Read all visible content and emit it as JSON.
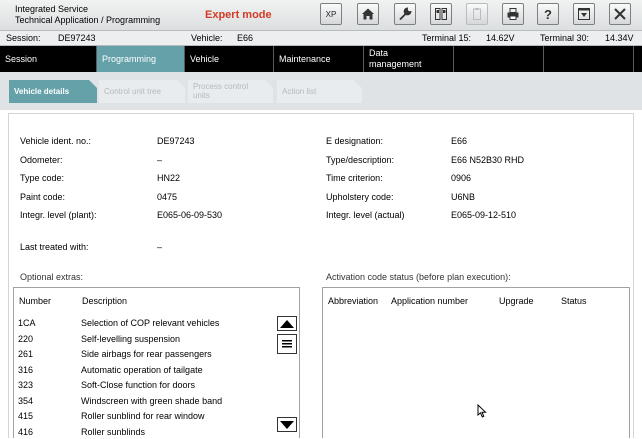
{
  "app": {
    "title_line1": "Integrated Service",
    "title_line2": "Technical Application / Programming",
    "mode": "Expert mode"
  },
  "toolbar": {
    "xp_label": "XP",
    "icons": [
      "home-icon",
      "wrench-icon",
      "device-icon",
      "clipboard-icon",
      "printer-icon",
      "help-icon",
      "minimize-icon",
      "close-icon"
    ]
  },
  "session": {
    "session_label": "Session:",
    "session_value": "DE97243",
    "vehicle_label": "Vehicle:",
    "vehicle_value": "E66",
    "t15_label": "Terminal 15:",
    "t15_value": "14.62V",
    "t30_label": "Terminal 30:",
    "t30_value": "14.34V"
  },
  "mainnav": {
    "session": "Session",
    "programming": "Programming",
    "vehicle": "Vehicle",
    "maintenance": "Maintenance",
    "data_mgmt_line1": "Data",
    "data_mgmt_line2": "management"
  },
  "subnav": {
    "vehicle_details": "Vehicle details",
    "control_unit_tree": "Control unit tree",
    "process_actions_line1": "Process control",
    "process_actions_line2": "units",
    "action_list": "Action list"
  },
  "details": {
    "vin_label": "Vehicle ident. no.:",
    "vin_value": "DE97243",
    "odometer_label": "Odometer:",
    "odometer_value": "–",
    "type_code_label": "Type code:",
    "type_code_value": "HN22",
    "paint_label": "Paint code:",
    "paint_value": "0475",
    "integr_plant_label": "Integr. level (plant):",
    "integr_plant_value": "E065-06-09-530",
    "last_treated_label": "Last treated with:",
    "last_treated_value": "–",
    "edesig_label": "E designation:",
    "edesig_value": "E66",
    "typedesc_label": "Type/description:",
    "typedesc_value": "E66 N52B30 RHD",
    "time_label": "Time criterion:",
    "time_value": "0906",
    "uphol_label": "Upholstery code:",
    "uphol_value": "U6NB",
    "integr_actual_label": "Integr. level (actual)",
    "integr_actual_value": "E065-09-12-510"
  },
  "optional_extras": {
    "title": "Optional extras:",
    "col_number": "Number",
    "col_description": "Description",
    "rows": [
      {
        "number": "1CA",
        "description": "Selection of COP relevant vehicles"
      },
      {
        "number": "220",
        "description": "Self-levelling suspension"
      },
      {
        "number": "261",
        "description": "Side airbags for rear passengers"
      },
      {
        "number": "316",
        "description": "Automatic operation of tailgate"
      },
      {
        "number": "323",
        "description": "Soft-Close function for doors"
      },
      {
        "number": "354",
        "description": "Windscreen with green shade band"
      },
      {
        "number": "415",
        "description": "Roller sunblind for rear window"
      },
      {
        "number": "416",
        "description": "Roller sunblinds"
      }
    ]
  },
  "activation": {
    "title": "Activation code status (before plan execution):",
    "col_abbrev": "Abbreviation",
    "col_appnum": "Application number",
    "col_upgrade": "Upgrade",
    "col_status": "Status"
  }
}
